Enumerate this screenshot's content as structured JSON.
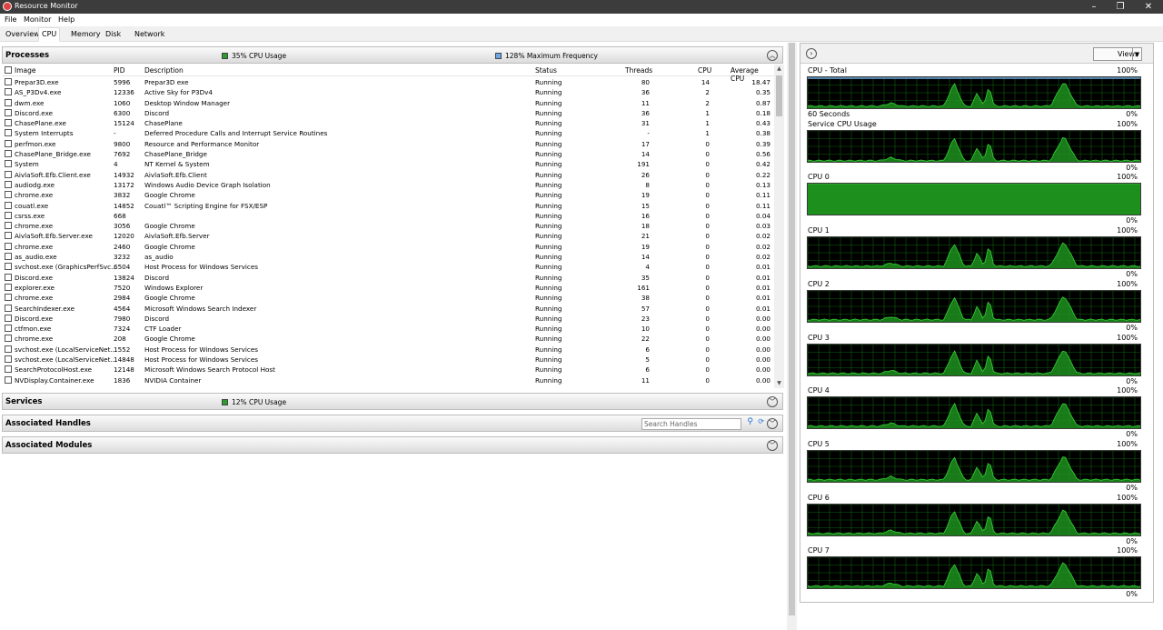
{
  "window": {
    "title": "Resource Monitor"
  },
  "menu": [
    "File",
    "Monitor",
    "Help"
  ],
  "tabs": [
    "Overview",
    "CPU",
    "Memory",
    "Disk",
    "Network"
  ],
  "processes": {
    "title": "Processes",
    "cpu_usage": "35% CPU Usage",
    "max_freq": "128% Maximum Frequency",
    "columns": [
      "Image",
      "PID",
      "Description",
      "Status",
      "Threads",
      "CPU",
      "Average CPU"
    ],
    "rows": [
      [
        "Prepar3D.exe",
        "5996",
        "Prepar3D exe",
        "Running",
        "80",
        "14",
        "18.47"
      ],
      [
        "AS_P3Dv4.exe",
        "12336",
        "Active Sky for P3Dv4",
        "Running",
        "36",
        "2",
        "0.35"
      ],
      [
        "dwm.exe",
        "1060",
        "Desktop Window Manager",
        "Running",
        "11",
        "2",
        "0.87"
      ],
      [
        "Discord.exe",
        "6300",
        "Discord",
        "Running",
        "36",
        "1",
        "0.18"
      ],
      [
        "ChasePlane.exe",
        "15124",
        "ChasePlane",
        "Running",
        "31",
        "1",
        "0.43"
      ],
      [
        "System Interrupts",
        "-",
        "Deferred Procedure Calls and Interrupt Service Routines",
        "Running",
        "-",
        "1",
        "0.38"
      ],
      [
        "perfmon.exe",
        "9800",
        "Resource and Performance Monitor",
        "Running",
        "17",
        "0",
        "0.39"
      ],
      [
        "ChasePlane_Bridge.exe",
        "7692",
        "ChasePlane_Bridge",
        "Running",
        "14",
        "0",
        "0.56"
      ],
      [
        "System",
        "4",
        "NT Kernel & System",
        "Running",
        "191",
        "0",
        "0.42"
      ],
      [
        "AivlaSoft.Efb.Client.exe",
        "14932",
        "AivlaSoft.Efb.Client",
        "Running",
        "26",
        "0",
        "0.22"
      ],
      [
        "audiodg.exe",
        "13172",
        "Windows Audio Device Graph Isolation",
        "Running",
        "8",
        "0",
        "0.13"
      ],
      [
        "chrome.exe",
        "3832",
        "Google Chrome",
        "Running",
        "19",
        "0",
        "0.11"
      ],
      [
        "couatl.exe",
        "14852",
        "Couatl™ Scripting Engine for FSX/ESP",
        "Running",
        "15",
        "0",
        "0.11"
      ],
      [
        "csrss.exe",
        "668",
        "",
        "Running",
        "16",
        "0",
        "0.04"
      ],
      [
        "chrome.exe",
        "3056",
        "Google Chrome",
        "Running",
        "18",
        "0",
        "0.03"
      ],
      [
        "AivlaSoft.Efb.Server.exe",
        "12020",
        "AivlaSoft.Efb.Server",
        "Running",
        "21",
        "0",
        "0.02"
      ],
      [
        "chrome.exe",
        "2460",
        "Google Chrome",
        "Running",
        "19",
        "0",
        "0.02"
      ],
      [
        "as_audio.exe",
        "3232",
        "as_audio",
        "Running",
        "14",
        "0",
        "0.02"
      ],
      [
        "svchost.exe (GraphicsPerfSvc...",
        "6504",
        "Host Process for Windows Services",
        "Running",
        "4",
        "0",
        "0.01"
      ],
      [
        "Discord.exe",
        "13824",
        "Discord",
        "Running",
        "35",
        "0",
        "0.01"
      ],
      [
        "explorer.exe",
        "7520",
        "Windows Explorer",
        "Running",
        "161",
        "0",
        "0.01"
      ],
      [
        "chrome.exe",
        "2984",
        "Google Chrome",
        "Running",
        "38",
        "0",
        "0.01"
      ],
      [
        "SearchIndexer.exe",
        "4564",
        "Microsoft Windows Search Indexer",
        "Running",
        "57",
        "0",
        "0.01"
      ],
      [
        "Discord.exe",
        "7980",
        "Discord",
        "Running",
        "23",
        "0",
        "0.00"
      ],
      [
        "ctfmon.exe",
        "7324",
        "CTF Loader",
        "Running",
        "10",
        "0",
        "0.00"
      ],
      [
        "chrome.exe",
        "208",
        "Google Chrome",
        "Running",
        "22",
        "0",
        "0.00"
      ],
      [
        "svchost.exe (LocalServiceNet...",
        "1552",
        "Host Process for Windows Services",
        "Running",
        "6",
        "0",
        "0.00"
      ],
      [
        "svchost.exe (LocalServiceNet...",
        "14848",
        "Host Process for Windows Services",
        "Running",
        "5",
        "0",
        "0.00"
      ],
      [
        "SearchProtocolHost.exe",
        "12148",
        "Microsoft Windows Search Protocol Host",
        "Running",
        "6",
        "0",
        "0.00"
      ],
      [
        "NVDisplay.Container.exe",
        "1836",
        "NVIDIA Container",
        "Running",
        "11",
        "0",
        "0.00"
      ]
    ]
  },
  "services": {
    "title": "Services",
    "cpu_usage": "12% CPU Usage"
  },
  "handles": {
    "title": "Associated Handles",
    "search_placeholder": "Search Handles"
  },
  "modules": {
    "title": "Associated Modules"
  },
  "right": {
    "views_label": "Views",
    "graphs": [
      {
        "title": "CPU - Total",
        "max": "100%",
        "min": "0%",
        "bottom_label": "60 Seconds",
        "level": 0.05
      },
      {
        "title": "Service CPU Usage",
        "max": "100%",
        "min": "0%",
        "level": 0.02
      },
      {
        "title": "CPU 0",
        "max": "100%",
        "min": "0%",
        "level": 1.0
      },
      {
        "title": "CPU 1",
        "max": "100%",
        "min": "0%",
        "level": 0.05
      },
      {
        "title": "CPU 2",
        "max": "100%",
        "min": "0%",
        "level": 0.05
      },
      {
        "title": "CPU 3",
        "max": "100%",
        "min": "0%",
        "level": 0.05
      },
      {
        "title": "CPU 4",
        "max": "100%",
        "min": "0%",
        "level": 0.05
      },
      {
        "title": "CPU 5",
        "max": "100%",
        "min": "0%",
        "level": 0.05
      },
      {
        "title": "CPU 6",
        "max": "100%",
        "min": "0%",
        "level": 0.05
      },
      {
        "title": "CPU 7",
        "max": "100%",
        "min": "0%",
        "level": 0.05
      }
    ]
  },
  "colors": {
    "cpu_legend": "#2e9b2e",
    "freq_legend": "#6fa7e6",
    "graph_fill": "#1d8f1d",
    "graph_line": "#34d334",
    "graph_bg": "#000000"
  }
}
